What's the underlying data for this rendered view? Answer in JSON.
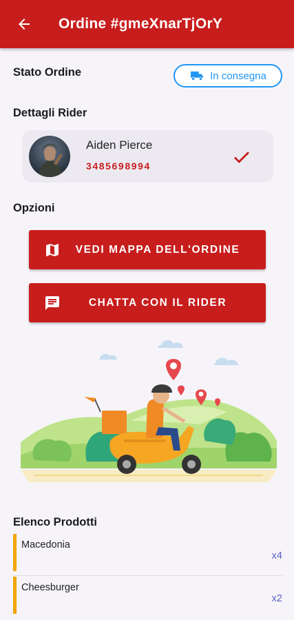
{
  "appbar": {
    "title": "Ordine #gmeXnarTjOrY",
    "back_icon": "arrow-back-icon"
  },
  "order_status": {
    "label": "Stato Ordine",
    "badge_text": "In consegna",
    "badge_icon": "truck-icon",
    "badge_color": "#2196f3"
  },
  "rider": {
    "section_label": "Dettagli Rider",
    "name": "Aiden Pierce",
    "phone": "3485698994",
    "verified_icon": "check-icon"
  },
  "options": {
    "section_label": "Opzioni",
    "buttons": [
      {
        "label": "VEDI MAPPA DELL'ORDINE",
        "icon": "map-icon"
      },
      {
        "label": "CHATTA CON IL RIDER",
        "icon": "chat-icon"
      }
    ]
  },
  "products": {
    "section_label": "Elenco Prodotti",
    "items": [
      {
        "name": "Macedonia",
        "qty": "x4"
      },
      {
        "name": "Cheesburger",
        "qty": "x2"
      }
    ]
  },
  "colors": {
    "primary": "#c81d1d",
    "accent_bar": "#f0a500",
    "qty_text": "#5c5fc0"
  }
}
